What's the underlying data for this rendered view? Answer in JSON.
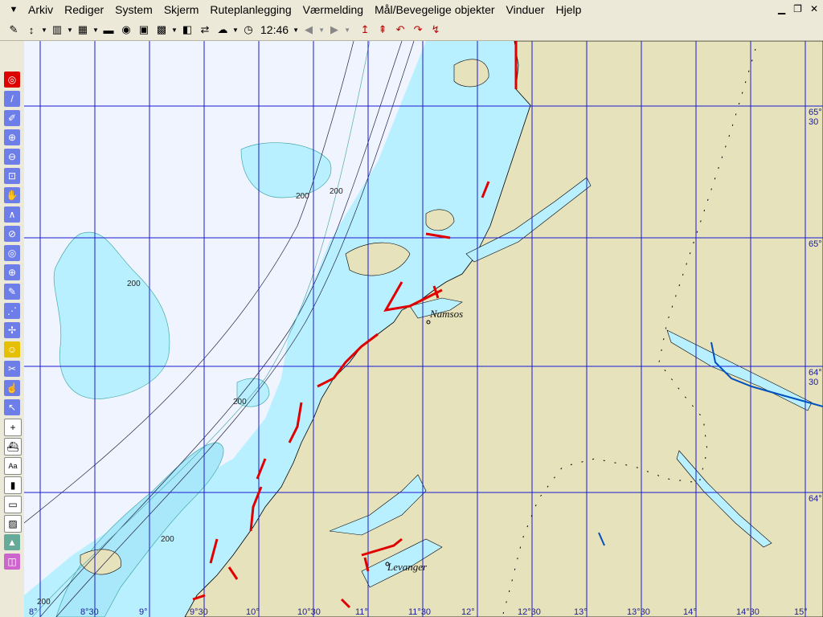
{
  "menu": {
    "items": [
      "Arkiv",
      "Rediger",
      "System",
      "Skjerm",
      "Ruteplanlegging",
      "Værmelding",
      "Mål/Bevegelige objekter",
      "Vinduer",
      "Hjelp"
    ]
  },
  "toolbar": {
    "clock": "12:46"
  },
  "map": {
    "places": [
      "Namsos",
      "Levanger"
    ],
    "lat_labels": [
      "65°",
      "30",
      "65°",
      "64°",
      "30",
      "64°"
    ],
    "lon_labels": [
      "8°",
      "8°30",
      "9°",
      "9°30",
      "10°",
      "10°30",
      "11°",
      "11°30",
      "12°",
      "12°30",
      "13°",
      "13°30",
      "14°",
      "14°30",
      "15°"
    ],
    "depth_labels": [
      "200",
      "200",
      "200",
      "200",
      "200",
      "200"
    ]
  }
}
